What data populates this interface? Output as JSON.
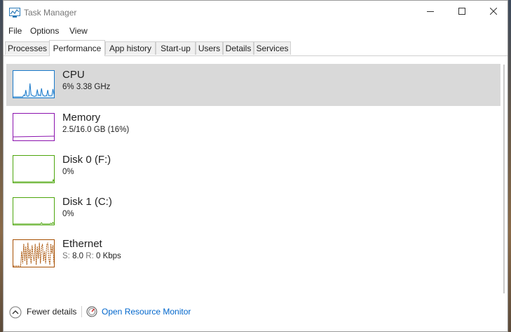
{
  "window": {
    "title": "Task Manager"
  },
  "menu": [
    "File",
    "Options",
    "View"
  ],
  "tabs": [
    "Processes",
    "Performance",
    "App history",
    "Start-up",
    "Users",
    "Details",
    "Services"
  ],
  "active_tab": "Performance",
  "resources": [
    {
      "name": "CPU",
      "detail": "6% 3.38 GHz",
      "color": "#1979ca",
      "selected": true,
      "usage": 0.06
    },
    {
      "name": "Memory",
      "detail": "2.5/16.0 GB (16%)",
      "color": "#8b12ae",
      "selected": false,
      "usage": 0.16
    },
    {
      "name": "Disk 0 (F:)",
      "detail": "0%",
      "color": "#4da60c",
      "selected": false,
      "usage": 0.0
    },
    {
      "name": "Disk 1 (C:)",
      "detail": "0%",
      "color": "#4da60c",
      "selected": false,
      "usage": 0.0
    },
    {
      "name": "Ethernet",
      "detail_prefix_s": "S:",
      "detail_s": "8.0",
      "detail_prefix_r": "R:",
      "detail_r": "0 Kbps",
      "color": "#a74f01",
      "selected": false
    }
  ],
  "footer": {
    "fewer_details": "Fewer details",
    "open_monitor": "Open Resource Monitor",
    "link_color": "#0066cc"
  }
}
